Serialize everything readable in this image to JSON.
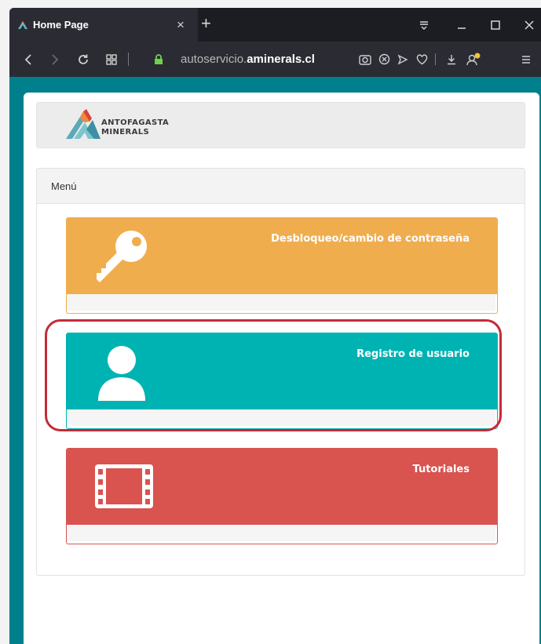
{
  "browser": {
    "tab_title": "Home Page",
    "tab_close": "×",
    "new_tab": "+",
    "url_prefix": "autoservicio.",
    "url_domain": "aminerals.cl"
  },
  "logo": {
    "line1": "ANTOFAGASTA",
    "line2": "MINERALS"
  },
  "menu": {
    "header": "Menú",
    "items": [
      {
        "label": "Desbloqueo/cambio de contraseña",
        "color": "#f0ad4e",
        "icon": "key-icon"
      },
      {
        "label": "Registro de usuario",
        "color": "#00b3b3",
        "icon": "user-icon"
      },
      {
        "label": "Tutoriales",
        "color": "#d9534f",
        "icon": "film-icon"
      }
    ]
  },
  "colors": {
    "viewport_bg": "#007f8c",
    "highlight": "#c42b38"
  }
}
